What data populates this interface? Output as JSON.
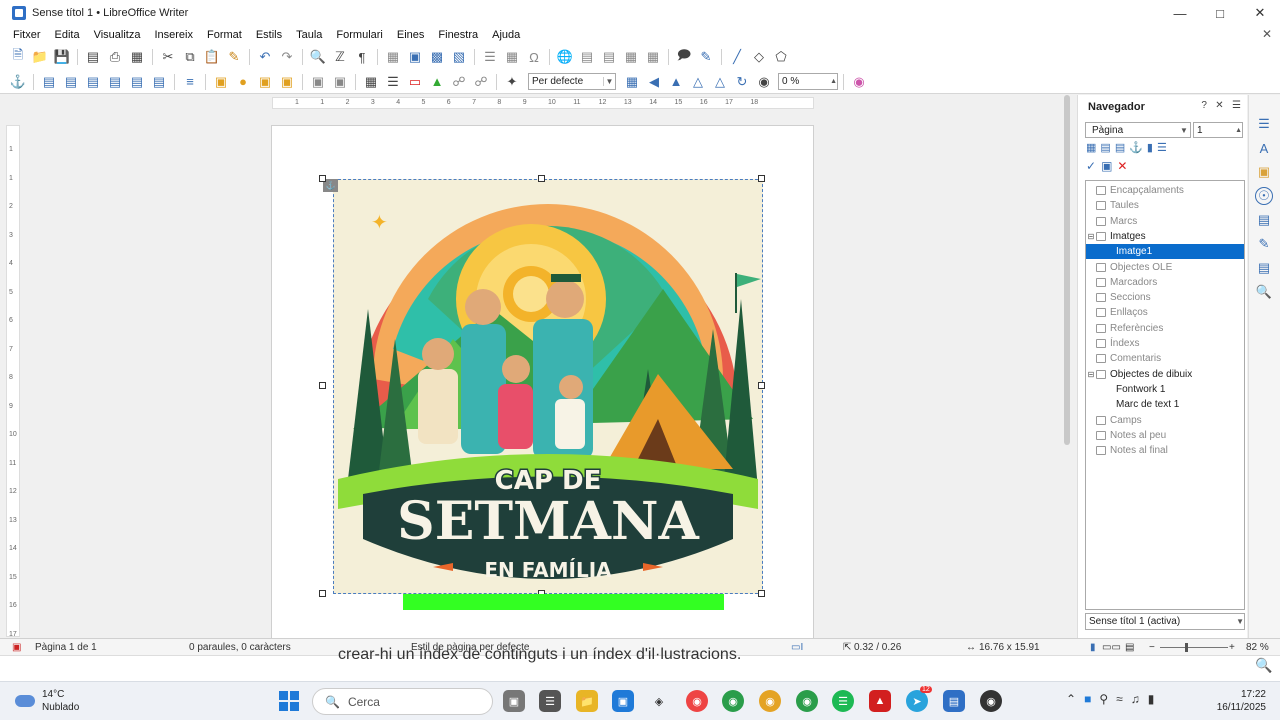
{
  "window": {
    "title": "Sense títol 1 • LibreOffice Writer"
  },
  "menu": [
    "Fitxer",
    "Edita",
    "Visualitza",
    "Insereix",
    "Format",
    "Estils",
    "Taula",
    "Formulari",
    "Eines",
    "Finestra",
    "Ajuda"
  ],
  "toolbar2": {
    "style_value": "Per defecte",
    "percent_value": "0 %"
  },
  "hruler_ticks": [
    "1",
    "1",
    "2",
    "3",
    "4",
    "5",
    "6",
    "7",
    "8",
    "9",
    "10",
    "11",
    "12",
    "13",
    "14",
    "15",
    "16",
    "17",
    "18"
  ],
  "vruler_ticks": [
    "1",
    "1",
    "2",
    "3",
    "4",
    "5",
    "6",
    "7",
    "8",
    "9",
    "10",
    "11",
    "12",
    "13",
    "14",
    "15",
    "16",
    "17"
  ],
  "image": {
    "title_line1": "CAP DE",
    "title_line2": "SETMANA",
    "title_line3": "EN FAMÍLIA"
  },
  "navigator": {
    "title": "Navegador",
    "category_select": "Pàgina",
    "page_number": "1",
    "tree": [
      {
        "label": "Encapçalaments",
        "state": "disabled"
      },
      {
        "label": "Taules",
        "state": "disabled"
      },
      {
        "label": "Marcs",
        "state": "disabled"
      },
      {
        "label": "Imatges",
        "state": "expanded"
      },
      {
        "label": "Imatge1",
        "state": "selected"
      },
      {
        "label": "Objectes OLE",
        "state": "disabled"
      },
      {
        "label": "Marcadors",
        "state": "disabled"
      },
      {
        "label": "Seccions",
        "state": "disabled"
      },
      {
        "label": "Enllaços",
        "state": "disabled"
      },
      {
        "label": "Referències",
        "state": "disabled"
      },
      {
        "label": "Índexs",
        "state": "disabled"
      },
      {
        "label": "Comentaris",
        "state": "disabled"
      },
      {
        "label": "Objectes de dibuix",
        "state": "expanded"
      },
      {
        "label": "Fontwork 1",
        "state": "child"
      },
      {
        "label": "Marc de text 1",
        "state": "child"
      },
      {
        "label": "Camps",
        "state": "disabled"
      },
      {
        "label": "Notes al peu",
        "state": "disabled"
      },
      {
        "label": "Notes al final",
        "state": "disabled"
      }
    ],
    "document_select": "Sense títol 1 (activa)"
  },
  "statusbar": {
    "page": "Pàgina 1 de 1",
    "words": "0 paraules, 0 caràcters",
    "page_style": "Estil de pàgina per defecte",
    "position": "0.32 / 0.26",
    "size": "16.76 x 15.91",
    "zoom": "82 %"
  },
  "behind_window_text": "crear-hi un índex de continguts i un índex d'il·lustracions.",
  "taskbar": {
    "weather_temp": "14°C",
    "weather_desc": "Nublado",
    "search_placeholder": "Cerca",
    "time": "17:22",
    "date": "16/11/2025",
    "telegram_badge": "12"
  },
  "colors": {
    "selection": "#0a6ccc",
    "accent": "#3a6fb3",
    "green_bar": "#33ff22"
  }
}
